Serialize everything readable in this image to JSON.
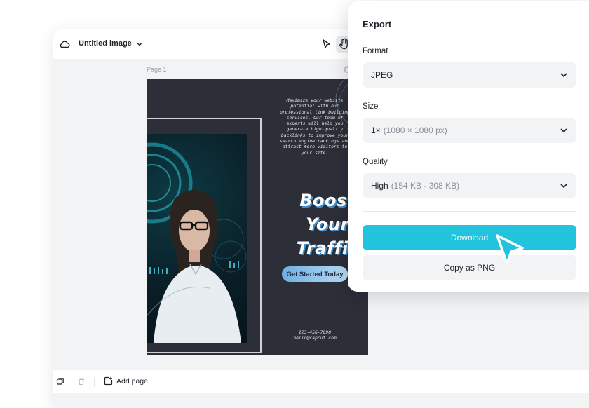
{
  "editor": {
    "doc_title": "Untitled image",
    "page_label": "Page 1",
    "add_page_label": "Add page"
  },
  "design": {
    "intro_lines": [
      "Maximize your website",
      "potential with our",
      "professional link building",
      "services. Our team of",
      "experts will help you",
      "generate high-quality",
      "backlinks to improve your",
      "search engine rankings and",
      "attract more visitors to",
      "your site."
    ],
    "headline": [
      "Boost",
      "Your",
      "Traffic"
    ],
    "cta": "Get Started Today",
    "phone": "123-456-7890",
    "email": "hello@capcut.com"
  },
  "export": {
    "title": "Export",
    "format_label": "Format",
    "format_value": "JPEG",
    "size_label": "Size",
    "size_value": "1×",
    "size_detail": "(1080 × 1080 px)",
    "quality_label": "Quality",
    "quality_value": "High",
    "quality_detail": "(154 KB - 308 KB)",
    "download_label": "Download",
    "copy_label": "Copy as PNG"
  },
  "colors": {
    "accent": "#22c3dc",
    "design_bg": "#2c2f38"
  },
  "icons": [
    "cloud-icon",
    "chevron-down-icon",
    "select-pointer-icon",
    "hand-icon",
    "layers-icon",
    "trash-icon",
    "add-page-icon",
    "mouse-cursor-icon"
  ]
}
